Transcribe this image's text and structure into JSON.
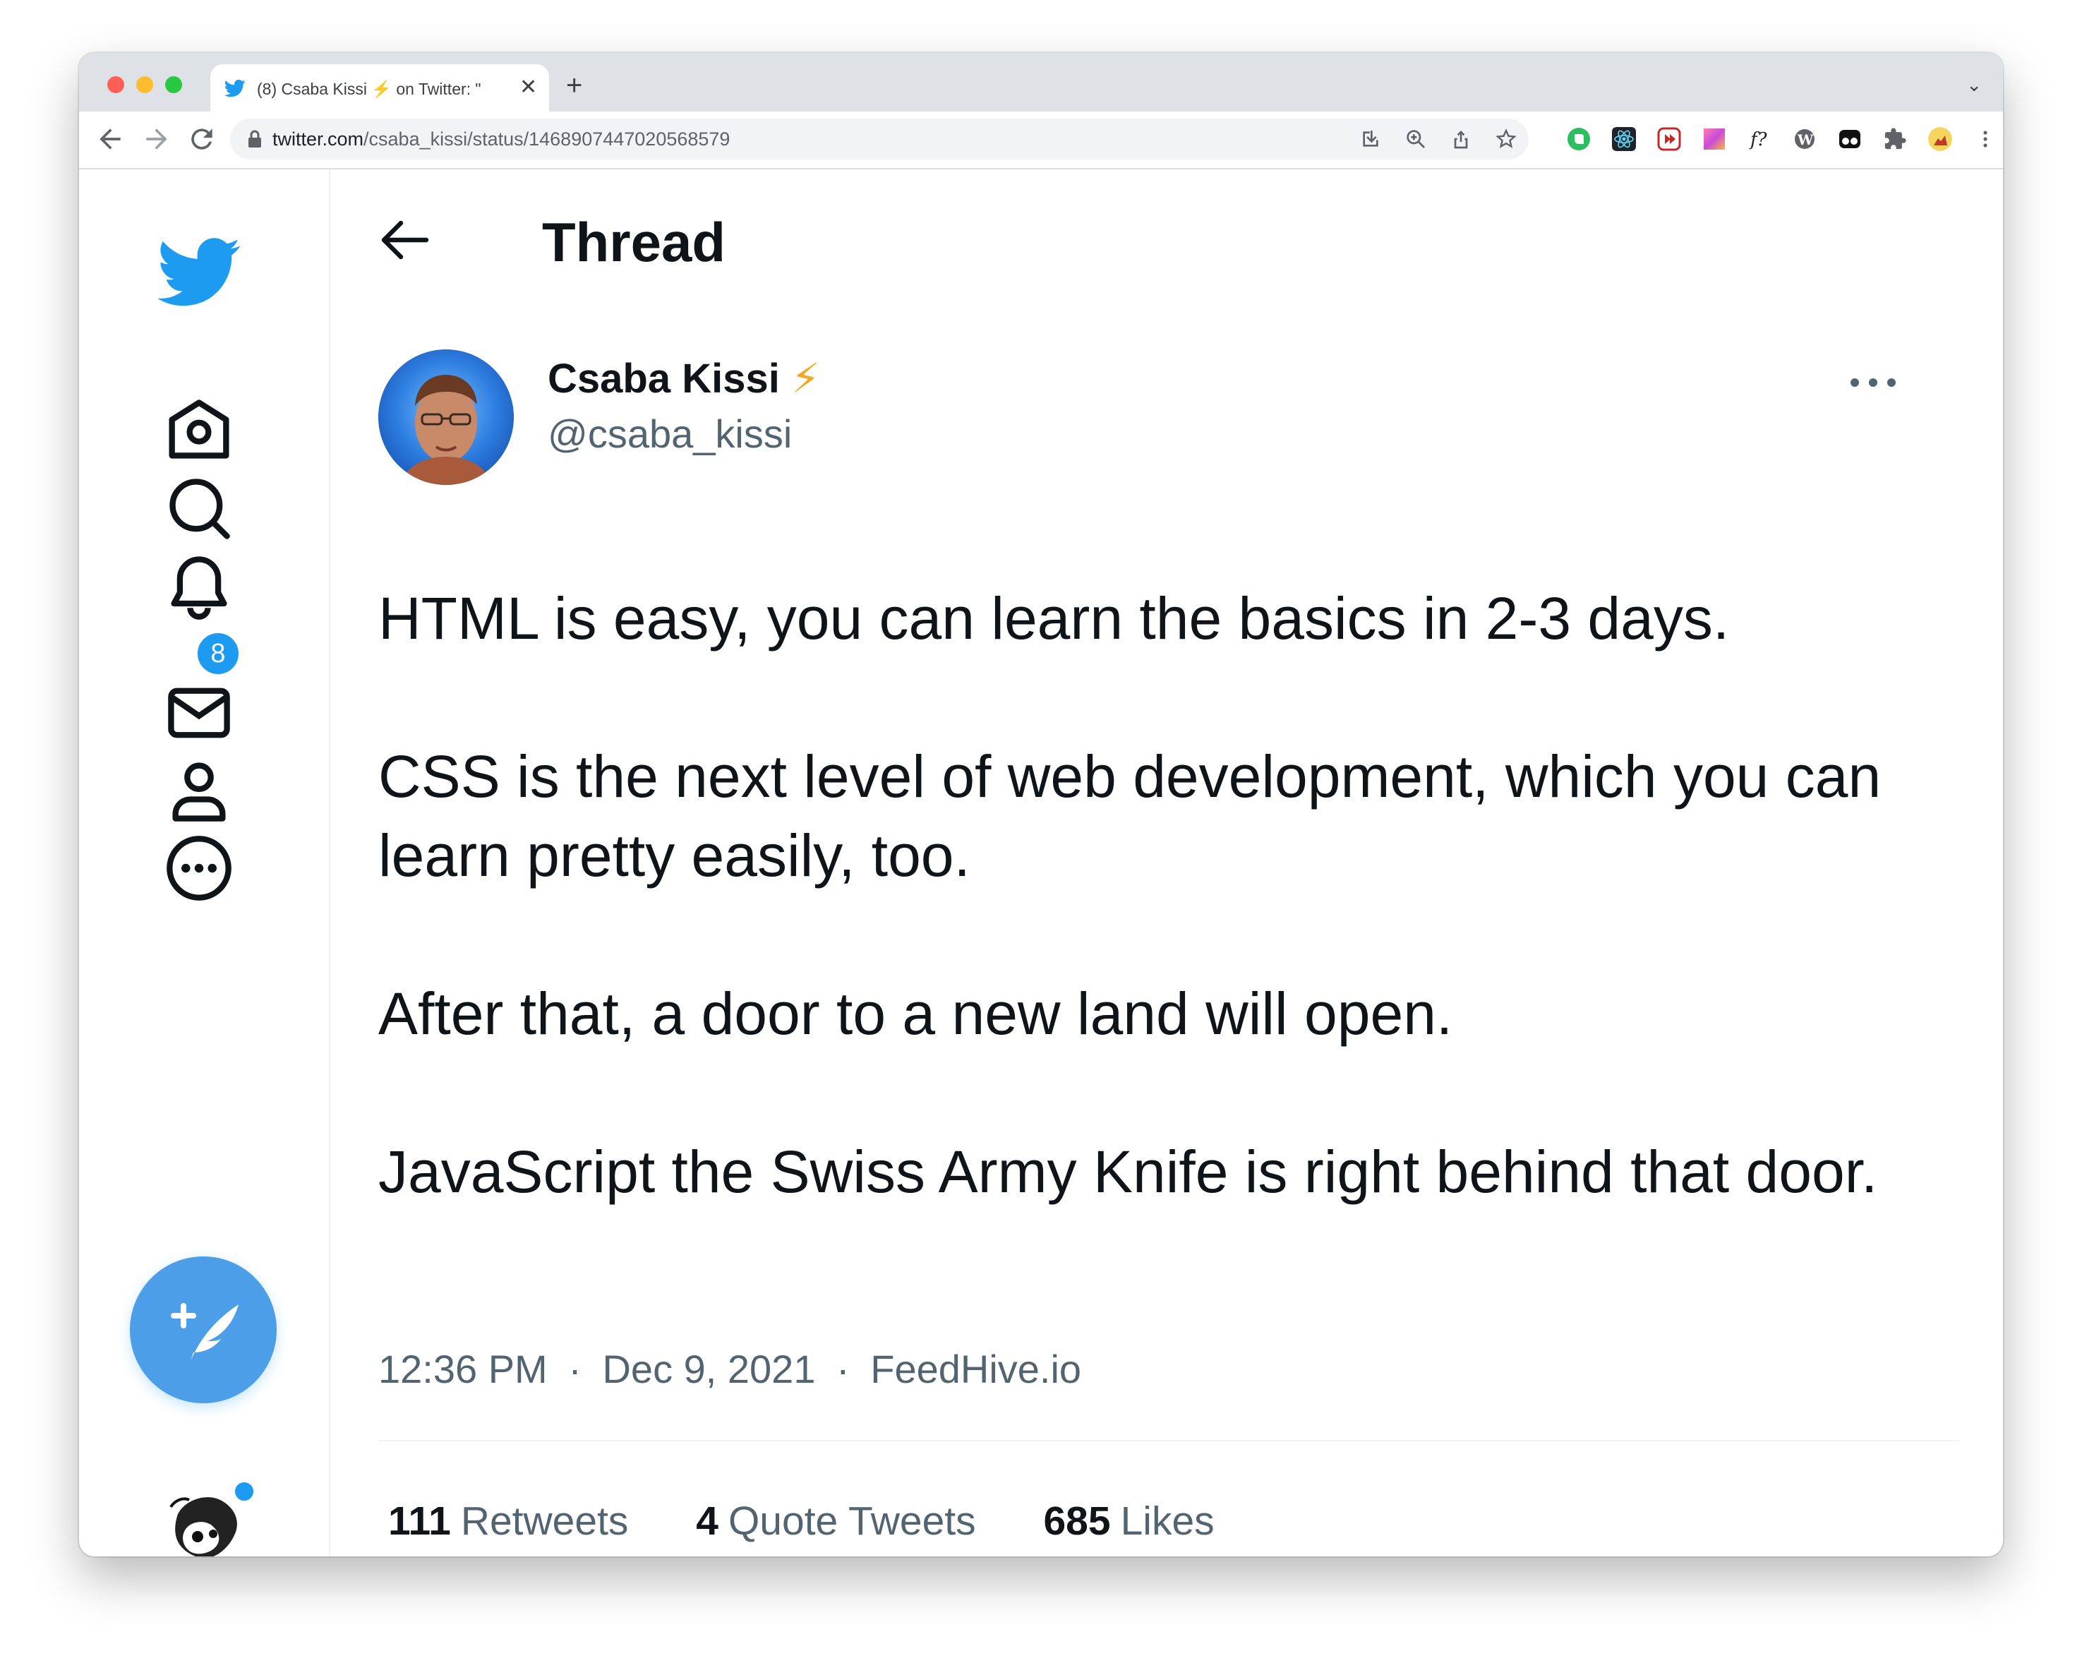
{
  "browser": {
    "tab": {
      "title": "(8) Csaba Kissi ⚡️ on Twitter: \"",
      "favicon": "twitter-bird-icon"
    },
    "url": {
      "host": "twitter.com",
      "path": "/csaba_kissi/status/1468907447020568579"
    },
    "toolbar_icons": [
      "back-icon",
      "forward-icon",
      "reload-icon",
      "lock-icon",
      "install-icon",
      "zoom-icon",
      "share-icon",
      "bookmark-star-icon"
    ],
    "extension_icons": [
      "evernote-icon",
      "react-devtools-icon",
      "extension-red-icon",
      "gradient-extension-icon",
      "fonts-ninja-icon",
      "wordpress-icon",
      "tampermonkey-icon",
      "puzzle-extensions-icon",
      "profile-avatar-icon",
      "kebab-menu-icon"
    ]
  },
  "sidebar": {
    "items": [
      "twitter-logo",
      "home-icon",
      "explore-icon",
      "notifications-icon",
      "messages-icon",
      "profile-icon",
      "more-icon"
    ],
    "notification_badge": "8",
    "compose": "tweet-compose-icon"
  },
  "header": {
    "title": "Thread"
  },
  "tweet": {
    "author_name": "Csaba Kissi",
    "author_emoji": "⚡",
    "author_handle": "@csaba_kissi",
    "paragraphs": [
      "HTML is easy, you can learn the basics in 2-3 days.",
      "CSS is the next level of web development, which you can learn pretty easily, too.",
      "After that, a door to a new land will open.",
      "JavaScript the Swiss Army Knife is right behind that door."
    ],
    "time": "12:36 PM",
    "date": "Dec 9, 2021",
    "source": "FeedHive.io",
    "separator": "·",
    "stats": {
      "retweets_count": "111",
      "retweets_label": "Retweets",
      "quotes_count": "4",
      "quotes_label": "Quote Tweets",
      "likes_count": "685",
      "likes_label": "Likes"
    }
  },
  "colors": {
    "twitter_blue": "#1d9bf0",
    "compose_button": "#4c9ee8",
    "text_primary": "#0f1419",
    "text_secondary": "#536471",
    "bolt": "#f5a623"
  }
}
